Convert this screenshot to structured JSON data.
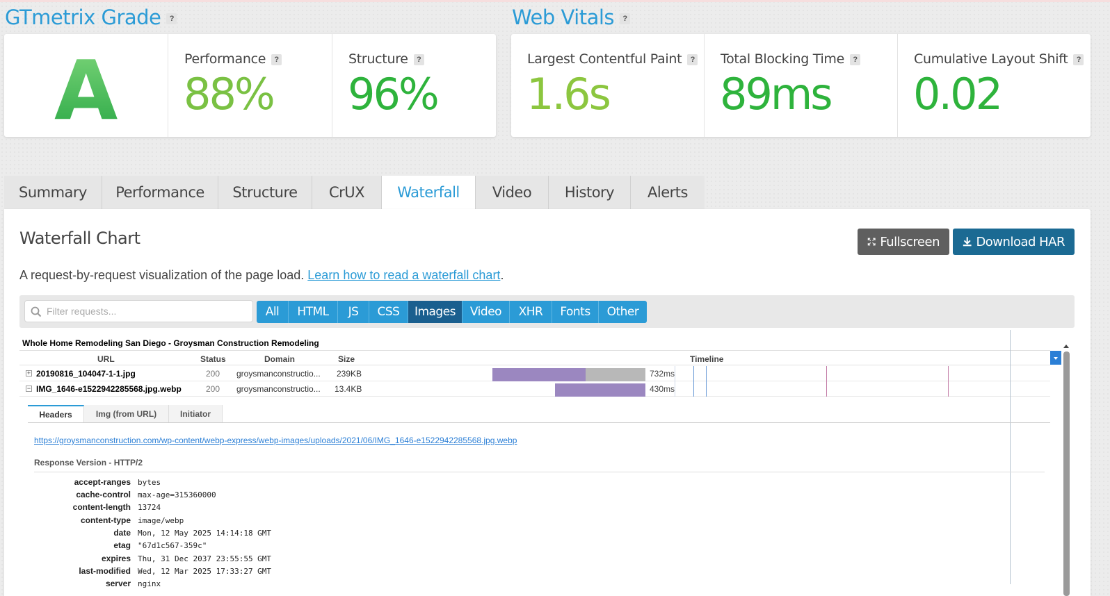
{
  "grade": {
    "title": "GTmetrix Grade",
    "help": "?",
    "letter": "A",
    "performance": {
      "label": "Performance",
      "value": "88%"
    },
    "structure": {
      "label": "Structure",
      "value": "96%"
    }
  },
  "vitals": {
    "title": "Web Vitals",
    "help": "?",
    "lcp": {
      "label": "Largest Contentful Paint",
      "value": "1.6s"
    },
    "tbt": {
      "label": "Total Blocking Time",
      "value": "89ms"
    },
    "cls": {
      "label": "Cumulative Layout Shift",
      "value": "0.02"
    }
  },
  "tabs": [
    "Summary",
    "Performance",
    "Structure",
    "CrUX",
    "Waterfall",
    "Video",
    "History",
    "Alerts"
  ],
  "active_tab": "Waterfall",
  "waterfall": {
    "title": "Waterfall Chart",
    "fullscreen_label": "Fullscreen",
    "download_label": "Download HAR",
    "description": "A request-by-request visualization of the page load.",
    "learn_link": "Learn how to read a waterfall chart",
    "period": ".",
    "filter_placeholder": "Filter requests...",
    "filters": [
      "All",
      "HTML",
      "JS",
      "CSS",
      "Images",
      "Video",
      "XHR",
      "Fonts",
      "Other"
    ],
    "active_filter": "Images"
  },
  "har": {
    "page_title": "Whole Home Remodeling San Diego - Groysman Construction Remodeling",
    "columns": {
      "url": "URL",
      "status": "Status",
      "domain": "Domain",
      "size": "Size",
      "timeline": "Timeline"
    },
    "rows": [
      {
        "toggle": "+",
        "url": "20190816_104047-1-1.jpg",
        "status": "200",
        "domain": "groysmanconstructio...",
        "size": "239KB",
        "time": "732ms"
      },
      {
        "toggle": "−",
        "url": "IMG_1646-e1522942285568.jpg.webp",
        "status": "200",
        "domain": "groysmanconstructio...",
        "size": "13.4KB",
        "time": "430ms"
      }
    ],
    "detail_tabs": [
      "Headers",
      "Img (from URL)",
      "Initiator"
    ],
    "active_detail_tab": "Headers",
    "detail_url": "https://groysmanconstruction.com/wp-content/webp-express/webp-images/uploads/2021/06/IMG_1646-e1522942285568.jpg.webp",
    "response_version": "Response Version - HTTP/2",
    "headers": [
      {
        "key": "accept-ranges",
        "value": "bytes"
      },
      {
        "key": "cache-control",
        "value": "max-age=315360000"
      },
      {
        "key": "content-length",
        "value": "13724"
      },
      {
        "key": "content-type",
        "value": "image/webp"
      },
      {
        "key": "date",
        "value": "Mon, 12 May 2025 14:14:18 GMT"
      },
      {
        "key": "etag",
        "value": "\"67d1c567-359c\""
      },
      {
        "key": "expires",
        "value": "Thu, 31 Dec 2037 23:55:55 GMT"
      },
      {
        "key": "last-modified",
        "value": "Wed, 12 Mar 2025 17:33:27 GMT"
      },
      {
        "key": "server",
        "value": "nginx"
      }
    ]
  },
  "colors": {
    "brand_blue": "#2b9bd6",
    "good_green": "#28a745",
    "lcp_green": "#8cc63f",
    "bar_wait": "#9b87c0",
    "bar_receive": "#b8b8b8"
  }
}
